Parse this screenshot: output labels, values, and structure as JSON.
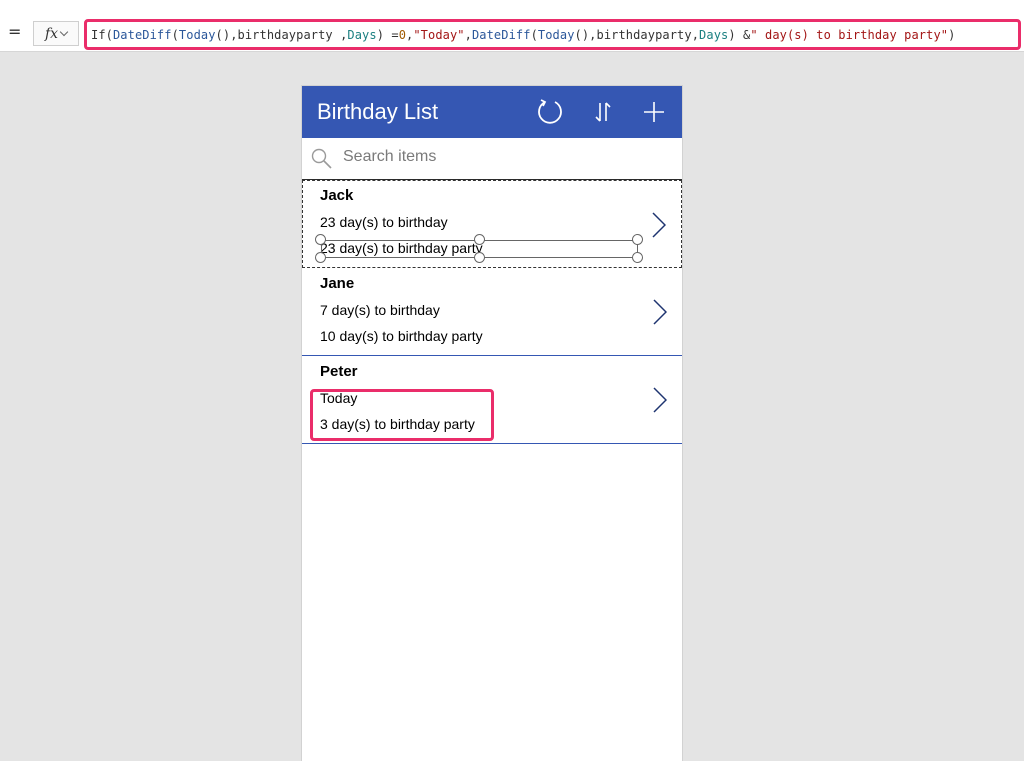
{
  "formula_bar": {
    "equals": "=",
    "fx_label": "fx",
    "formula": [
      {
        "t": "If(",
        "c": "p"
      },
      {
        "t": "DateDiff",
        "c": "fn"
      },
      {
        "t": "(",
        "c": "p"
      },
      {
        "t": "Today",
        "c": "fn"
      },
      {
        "t": "(),birthdayparty ,",
        "c": "p"
      },
      {
        "t": "Days",
        "c": "kw"
      },
      {
        "t": ") = ",
        "c": "p"
      },
      {
        "t": "0",
        "c": "num"
      },
      {
        "t": ", ",
        "c": "p"
      },
      {
        "t": "\"Today\"",
        "c": "str"
      },
      {
        "t": ", ",
        "c": "p"
      },
      {
        "t": "DateDiff",
        "c": "fn"
      },
      {
        "t": "(",
        "c": "p"
      },
      {
        "t": "Today",
        "c": "fn"
      },
      {
        "t": "(),birthdayparty,",
        "c": "p"
      },
      {
        "t": "Days",
        "c": "kw"
      },
      {
        "t": ") & ",
        "c": "p"
      },
      {
        "t": "\" day(s) to birthday party\"",
        "c": "str"
      },
      {
        "t": ")",
        "c": "p"
      }
    ]
  },
  "app": {
    "title": "Birthday List",
    "icons": [
      "refresh-icon",
      "sort-icon",
      "add-icon"
    ],
    "search": {
      "placeholder": "Search items"
    },
    "items": [
      {
        "name": "Jack",
        "line1": "23 day(s) to birthday",
        "line2": "23 day(s) to birthday party",
        "selected": true
      },
      {
        "name": "Jane",
        "line1": "7 day(s) to birthday",
        "line2": "10 day(s) to birthday party",
        "selected": false
      },
      {
        "name": "Peter",
        "line1": "Today",
        "line2": "3 day(s) to birthday party",
        "selected": false
      }
    ]
  },
  "colors": {
    "header": "#3557b3",
    "highlight": "#ea2d6a",
    "chevron": "#1e3470"
  }
}
